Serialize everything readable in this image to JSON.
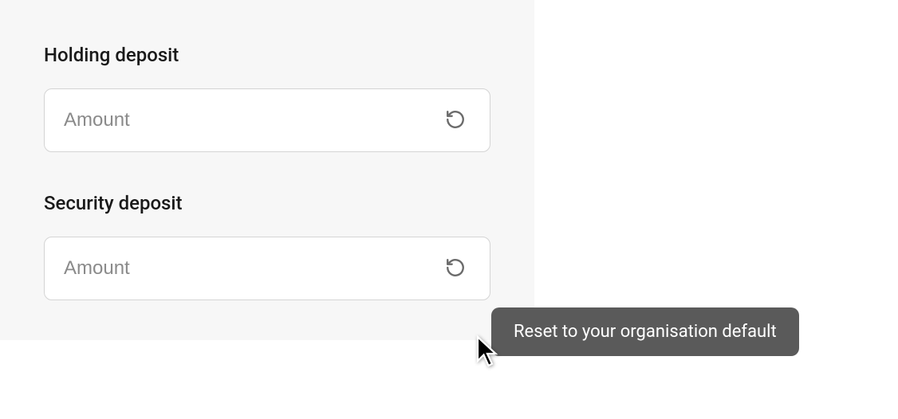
{
  "fields": {
    "holding_deposit": {
      "label": "Holding deposit",
      "placeholder": "Amount",
      "value": ""
    },
    "security_deposit": {
      "label": "Security deposit",
      "placeholder": "Amount",
      "value": ""
    }
  },
  "tooltip": {
    "reset": "Reset to your organisation default"
  }
}
